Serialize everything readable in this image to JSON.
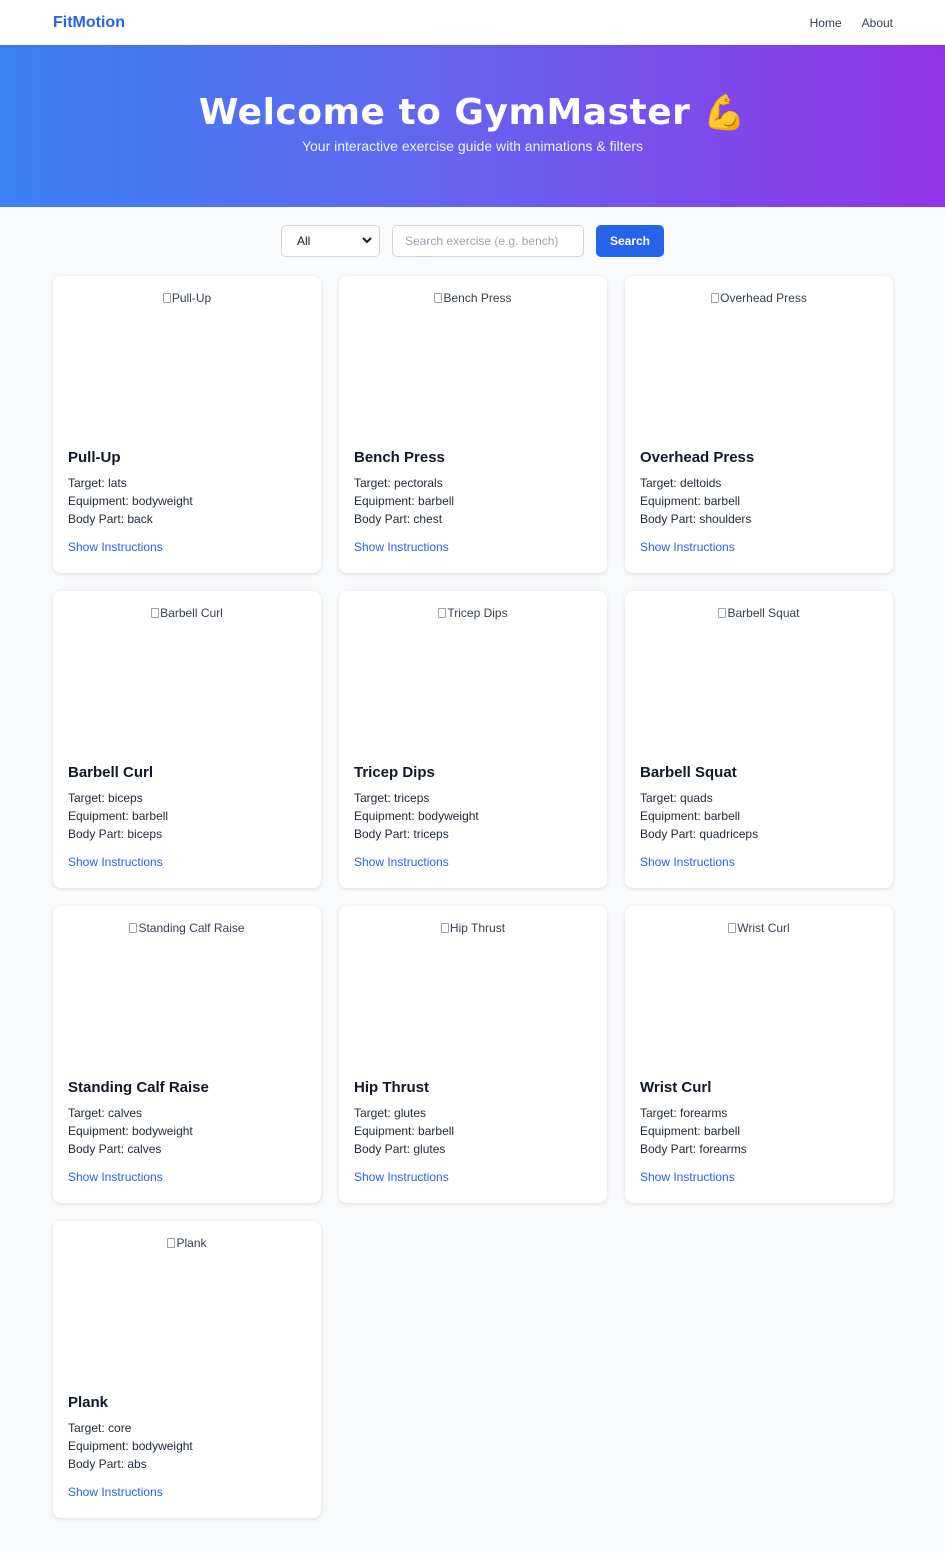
{
  "nav": {
    "brand": "FitMotion",
    "links": [
      "Home",
      "About"
    ]
  },
  "hero": {
    "title": "Welcome to GymMaster",
    "emoji": "💪",
    "subtitle": "Your interactive exercise guide with animations & filters"
  },
  "filters": {
    "selected": "All",
    "search_placeholder": "Search exercise (e.g. bench)",
    "search_value": "",
    "search_button": "Search"
  },
  "labels": {
    "target": "Target: ",
    "equipment": "Equipment: ",
    "body_part": "Body Part: ",
    "show_instructions": "Show Instructions"
  },
  "exercises": [
    {
      "name": "Pull-Up",
      "target": "lats",
      "equipment": "bodyweight",
      "body_part": "back"
    },
    {
      "name": "Bench Press",
      "target": "pectorals",
      "equipment": "barbell",
      "body_part": "chest"
    },
    {
      "name": "Overhead Press",
      "target": "deltoids",
      "equipment": "barbell",
      "body_part": "shoulders"
    },
    {
      "name": "Barbell Curl",
      "target": "biceps",
      "equipment": "barbell",
      "body_part": "biceps"
    },
    {
      "name": "Tricep Dips",
      "target": "triceps",
      "equipment": "bodyweight",
      "body_part": "triceps"
    },
    {
      "name": "Barbell Squat",
      "target": "quads",
      "equipment": "barbell",
      "body_part": "quadriceps"
    },
    {
      "name": "Standing Calf Raise",
      "target": "calves",
      "equipment": "bodyweight",
      "body_part": "calves"
    },
    {
      "name": "Hip Thrust",
      "target": "glutes",
      "equipment": "barbell",
      "body_part": "glutes"
    },
    {
      "name": "Wrist Curl",
      "target": "forearms",
      "equipment": "barbell",
      "body_part": "forearms"
    },
    {
      "name": "Plank",
      "target": "core",
      "equipment": "bodyweight",
      "body_part": "abs"
    }
  ],
  "colors": {
    "brand": "#2563eb",
    "hero_start": "#3b82f6",
    "hero_end": "#9333ea"
  }
}
